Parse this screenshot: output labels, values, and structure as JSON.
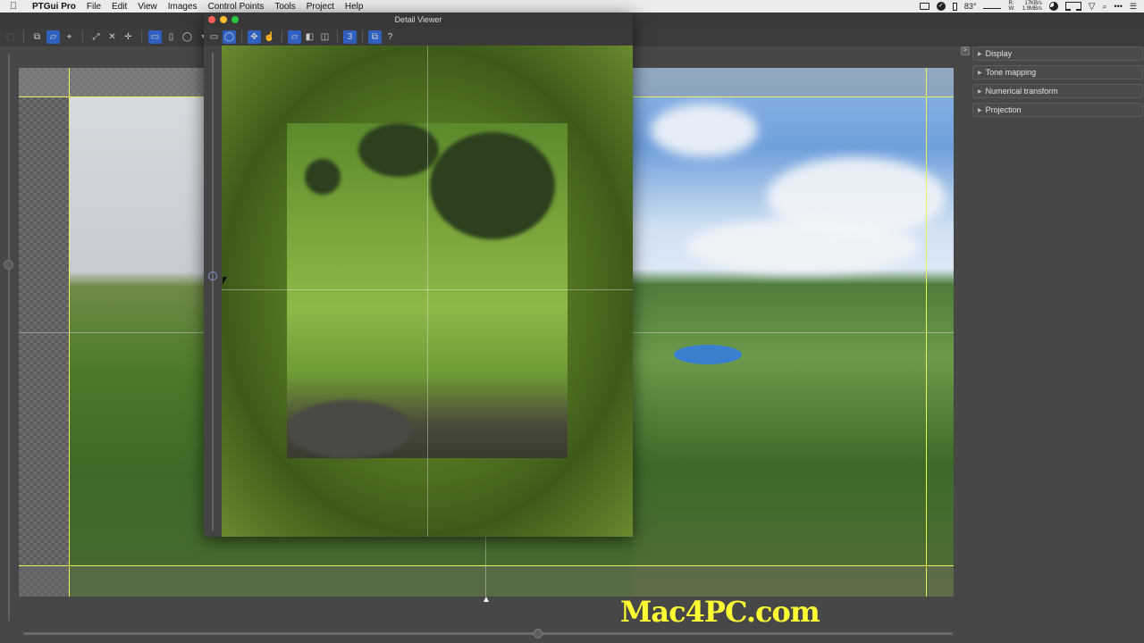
{
  "menubar": {
    "apple": "",
    "app_name": "PTGui Pro",
    "items": [
      "File",
      "Edit",
      "View",
      "Images",
      "Control Points",
      "Tools",
      "Project",
      "Help"
    ],
    "status": {
      "temperature": "83°",
      "net_r_label": "R:",
      "net_w_label": "W:",
      "net_r": "17KB/s",
      "net_w": "1.9MB/s"
    }
  },
  "main_toolbar": {
    "icons": [
      "select-tool-icon",
      "pano-preview-icon",
      "perspective-icon",
      "center-point-icon",
      "fit-panorama-icon",
      "shrink-panorama-icon",
      "straighten-icon",
      "rectilinear-projection-icon",
      "cylindrical-projection-icon",
      "spherical-projection-icon",
      "projection-dropdown-icon"
    ]
  },
  "detail_viewer": {
    "title": "Detail Viewer",
    "toolbar_icons": [
      "rectangle-view-icon",
      "spherical-view-icon",
      "move-icon",
      "hand-icon",
      "panorama-icon",
      "blend-icon",
      "split-icon",
      "number-icon",
      "layers-icon",
      "help-icon"
    ],
    "active_tools": [
      "spherical-view-icon",
      "move-icon",
      "panorama-icon",
      "number-icon",
      "layers-icon"
    ],
    "number_label": "3",
    "help_label": "?"
  },
  "right_panel": {
    "toggle_label": ">",
    "sections": [
      {
        "label": "Display"
      },
      {
        "label": "Tone mapping"
      },
      {
        "label": "Numerical transform"
      },
      {
        "label": "Projection"
      }
    ]
  },
  "sliders": {
    "vertical_zoom_fraction": 0.37,
    "horizontal_position_fraction": 0.55,
    "detail_viewer_zoom_fraction": 0.47
  },
  "watermark": "Mac4PC.com",
  "colors": {
    "accent": "#2f5fbf",
    "guide": "#e8f25a",
    "watermark": "#ffff33",
    "traffic_close": "#ff5f57",
    "traffic_min": "#febc2e",
    "traffic_max": "#28c840"
  }
}
